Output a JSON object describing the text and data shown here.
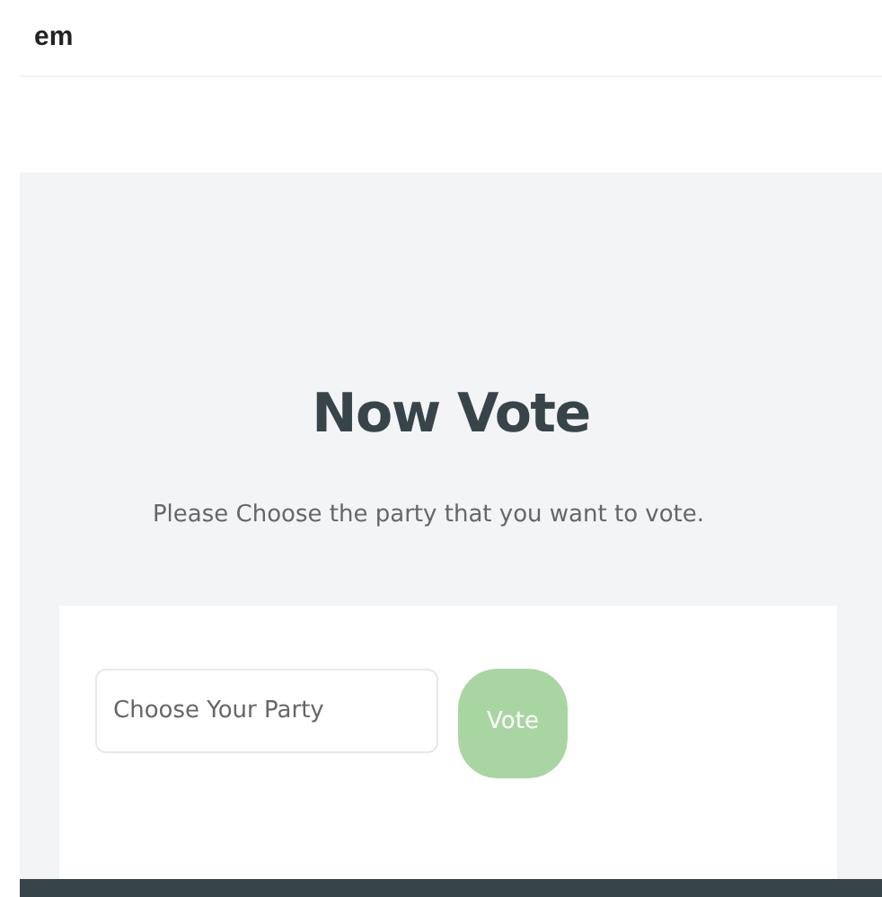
{
  "header": {
    "brand": "em"
  },
  "hero": {
    "title": "Now Vote",
    "subtitle": "Please Choose the party that you want to vote."
  },
  "form": {
    "party_field": {
      "placeholder": "Choose Your Party"
    },
    "vote_button": {
      "label": "Vote",
      "disabled": true
    }
  }
}
